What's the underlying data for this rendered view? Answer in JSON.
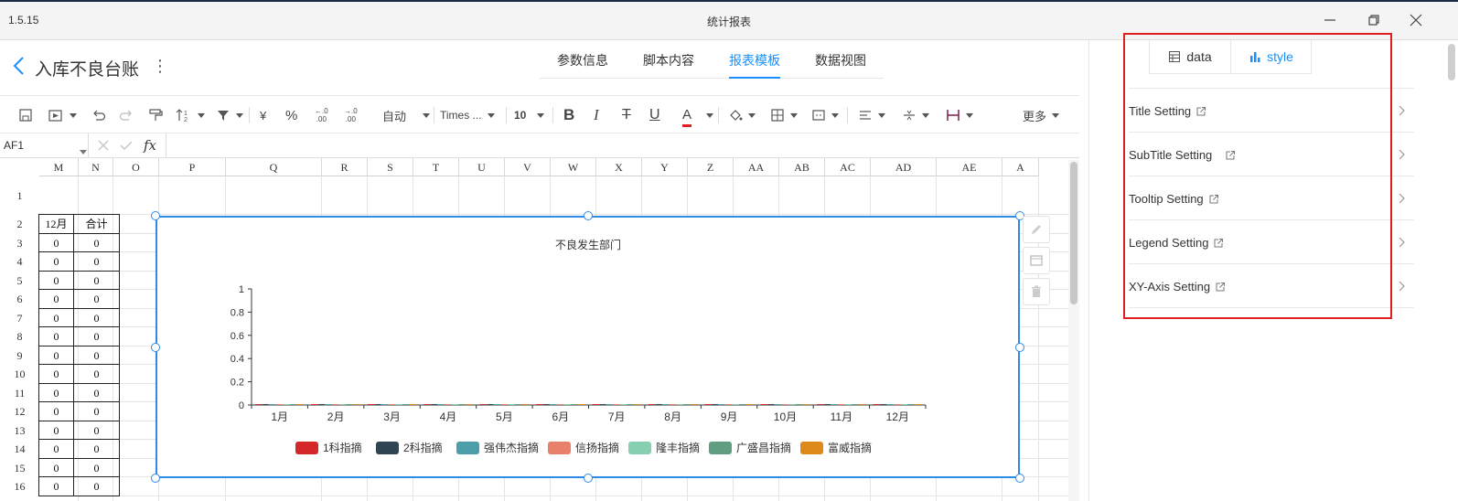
{
  "window": {
    "version": "1.5.15",
    "title": "统计报表"
  },
  "header": {
    "doc_title": "入库不良台账",
    "kebab": "⋮"
  },
  "tabs": [
    {
      "label": "参数信息",
      "active": false
    },
    {
      "label": "脚本内容",
      "active": false
    },
    {
      "label": "报表模板",
      "active": true
    },
    {
      "label": "数据视图",
      "active": false
    }
  ],
  "toolbar": {
    "currency": "¥",
    "percent": "%",
    "dec_less": ".00",
    "dec_less_top": "←.0",
    "dec_more": ".00",
    "dec_more_top": "→.0",
    "format": "自动",
    "font": "Times ...",
    "size": "10",
    "bold": "B",
    "italic": "I",
    "strike": "T",
    "underline": "U",
    "font_color": "A",
    "more": "更多"
  },
  "formula": {
    "cell_ref": "AF1",
    "fx": "fx"
  },
  "columns": [
    "M",
    "N",
    "O",
    "P",
    "Q",
    "R",
    "S",
    "T",
    "U",
    "V",
    "W",
    "X",
    "Y",
    "Z",
    "AA",
    "AB",
    "AC",
    "AD",
    "AE",
    "A"
  ],
  "rows": [
    "1",
    "2",
    "3",
    "4",
    "5",
    "6",
    "7",
    "8",
    "9",
    "10",
    "11",
    "12",
    "13",
    "14",
    "15",
    "16"
  ],
  "table_headers": {
    "col_m": "12月",
    "col_n": "合计"
  },
  "table_values": [
    [
      "0",
      "0"
    ],
    [
      "0",
      "0"
    ],
    [
      "0",
      "0"
    ],
    [
      "0",
      "0"
    ],
    [
      "0",
      "0"
    ],
    [
      "0",
      "0"
    ],
    [
      "0",
      "0"
    ],
    [
      "0",
      "0"
    ],
    [
      "0",
      "0"
    ],
    [
      "0",
      "0"
    ],
    [
      "0",
      "0"
    ],
    [
      "0",
      "0"
    ],
    [
      "0",
      "0"
    ],
    [
      "0",
      "0"
    ]
  ],
  "chart_data": {
    "type": "bar",
    "title": "不良发生部门",
    "categories": [
      "1月",
      "2月",
      "3月",
      "4月",
      "5月",
      "6月",
      "7月",
      "8月",
      "9月",
      "10月",
      "11月",
      "12月"
    ],
    "series": [
      {
        "name": "1科指摘",
        "color": "#d62728",
        "values": [
          0,
          0,
          0,
          0,
          0,
          0,
          0,
          0,
          0,
          0,
          0,
          0
        ]
      },
      {
        "name": "2科指摘",
        "color": "#2f4554",
        "values": [
          0,
          0,
          0,
          0,
          0,
          0,
          0,
          0,
          0,
          0,
          0,
          0
        ]
      },
      {
        "name": "强伟杰指摘",
        "color": "#4a9fa8",
        "values": [
          0,
          0,
          0,
          0,
          0,
          0,
          0,
          0,
          0,
          0,
          0,
          0
        ]
      },
      {
        "name": "信扬指摘",
        "color": "#e8806a",
        "values": [
          0,
          0,
          0,
          0,
          0,
          0,
          0,
          0,
          0,
          0,
          0,
          0
        ]
      },
      {
        "name": "隆丰指摘",
        "color": "#86cfb0",
        "values": [
          0,
          0,
          0,
          0,
          0,
          0,
          0,
          0,
          0,
          0,
          0,
          0
        ]
      },
      {
        "name": "广盛昌指摘",
        "color": "#5f9e80",
        "values": [
          0,
          0,
          0,
          0,
          0,
          0,
          0,
          0,
          0,
          0,
          0,
          0
        ]
      },
      {
        "name": "富威指摘",
        "color": "#dd8a1a",
        "values": [
          0,
          0,
          0,
          0,
          0,
          0,
          0,
          0,
          0,
          0,
          0,
          0
        ]
      }
    ],
    "yticks": [
      "0",
      "0.2",
      "0.4",
      "0.6",
      "0.8",
      "1"
    ],
    "ylim": [
      0,
      1
    ],
    "legend_position": "bottom"
  },
  "right_panel": {
    "tabs": [
      {
        "label": "data",
        "active": false
      },
      {
        "label": "style",
        "active": true
      }
    ],
    "settings": [
      {
        "label": "Title Setting"
      },
      {
        "label": "SubTitle Setting"
      },
      {
        "label": "Tooltip Setting"
      },
      {
        "label": "Legend Setting"
      },
      {
        "label": "XY-Axis Setting"
      }
    ]
  },
  "colors": {
    "accent": "#1890ff",
    "highlight": "#e02020",
    "chart_border": "#2e8ae6"
  }
}
